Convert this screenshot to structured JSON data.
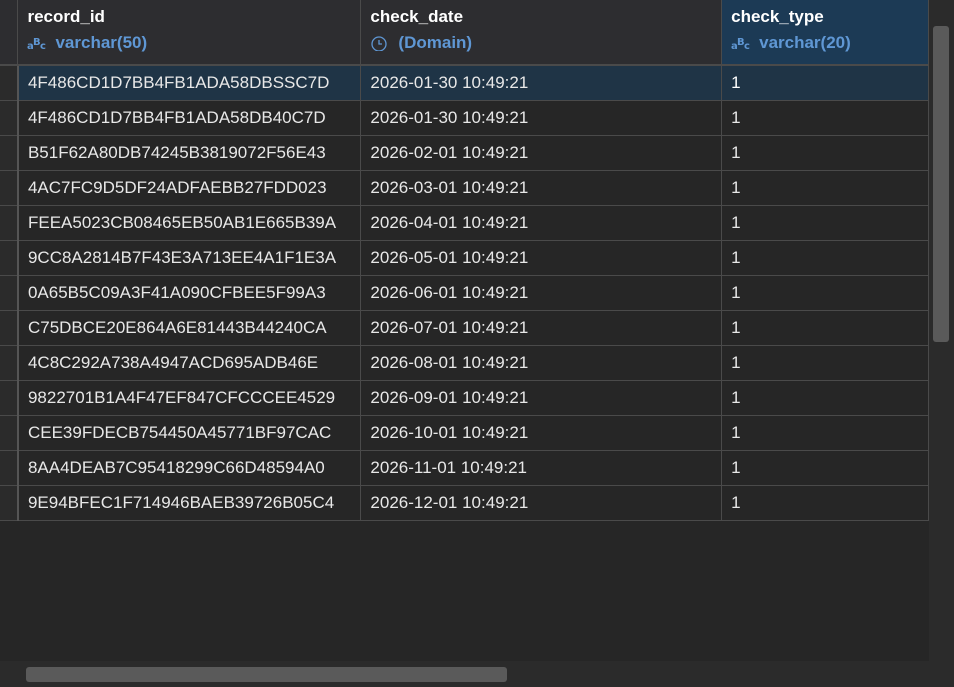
{
  "columns": [
    {
      "name": "record_id",
      "type": "varchar(50)",
      "type_icon": "text-type-icon"
    },
    {
      "name": "check_date",
      "type": "(Domain)",
      "type_icon": "clock-icon"
    },
    {
      "name": "check_type",
      "type": "varchar(20)",
      "type_icon": "text-type-icon"
    }
  ],
  "rows": [
    {
      "record_id": "4F486CD1D7BB4FB1ADA58DBSSC7D",
      "check_date": "2026-01-30 10:49:21",
      "check_type": "1"
    },
    {
      "record_id": "4F486CD1D7BB4FB1ADA58DB40C7D",
      "check_date": "2026-01-30 10:49:21",
      "check_type": "1"
    },
    {
      "record_id": "B51F62A80DB74245B3819072F56E43",
      "check_date": "2026-02-01 10:49:21",
      "check_type": "1"
    },
    {
      "record_id": "4AC7FC9D5DF24ADFAEBB27FDD023",
      "check_date": "2026-03-01 10:49:21",
      "check_type": "1"
    },
    {
      "record_id": "FEEA5023CB08465EB50AB1E665B39A",
      "check_date": "2026-04-01 10:49:21",
      "check_type": "1"
    },
    {
      "record_id": "9CC8A2814B7F43E3A713EE4A1F1E3A",
      "check_date": "2026-05-01 10:49:21",
      "check_type": "1"
    },
    {
      "record_id": "0A65B5C09A3F41A090CFBEE5F99A3",
      "check_date": "2026-06-01 10:49:21",
      "check_type": "1"
    },
    {
      "record_id": "C75DBCE20E864A6E81443B44240CA",
      "check_date": "2026-07-01 10:49:21",
      "check_type": "1"
    },
    {
      "record_id": "4C8C292A738A4947ACD695ADB46E",
      "check_date": "2026-08-01 10:49:21",
      "check_type": "1"
    },
    {
      "record_id": "9822701B1A4F47EF847CFCCCEE4529",
      "check_date": "2026-09-01 10:49:21",
      "check_type": "1"
    },
    {
      "record_id": "CEE39FDECB754450A45771BF97CAC",
      "check_date": "2026-10-01 10:49:21",
      "check_type": "1"
    },
    {
      "record_id": "8AA4DEAB7C95418299C66D48594A0",
      "check_date": "2026-11-01 10:49:21",
      "check_type": "1"
    },
    {
      "record_id": "9E94BFEC1F714946BAEB39726B05C4",
      "check_date": "2026-12-01 10:49:21",
      "check_type": "1"
    }
  ],
  "colors": {
    "selected_cell": "#0a64c8",
    "type_text": "#5f97d4",
    "background": "#262626"
  }
}
